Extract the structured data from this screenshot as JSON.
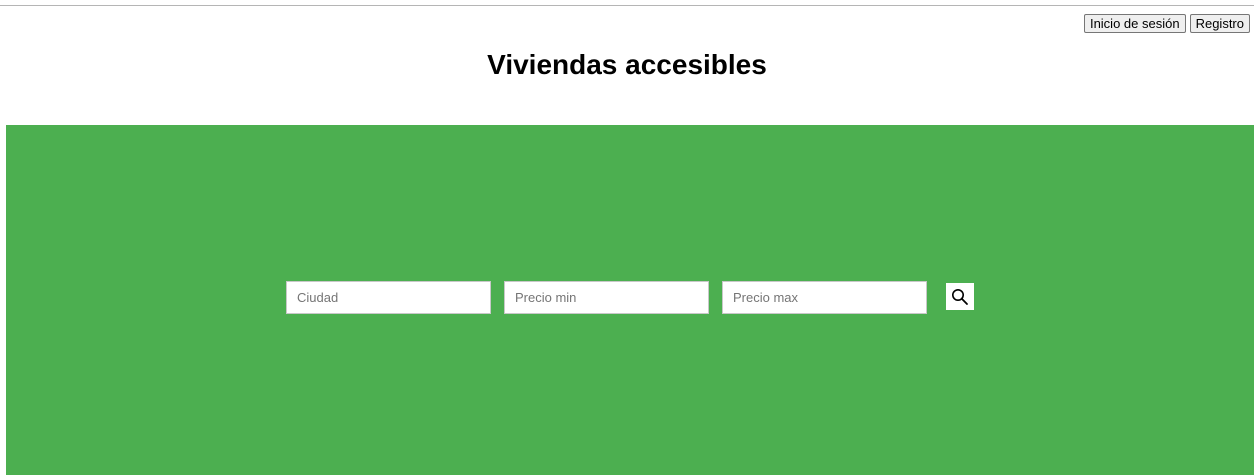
{
  "header": {
    "login_label": "Inicio de sesión",
    "register_label": "Registro",
    "title": "Viviendas accesibles"
  },
  "search": {
    "city_placeholder": "Ciudad",
    "price_min_placeholder": "Precio min",
    "price_max_placeholder": "Precio max",
    "button_icon": "search-icon"
  },
  "colors": {
    "hero_background": "#4caf50",
    "page_background": "#ffffff"
  }
}
